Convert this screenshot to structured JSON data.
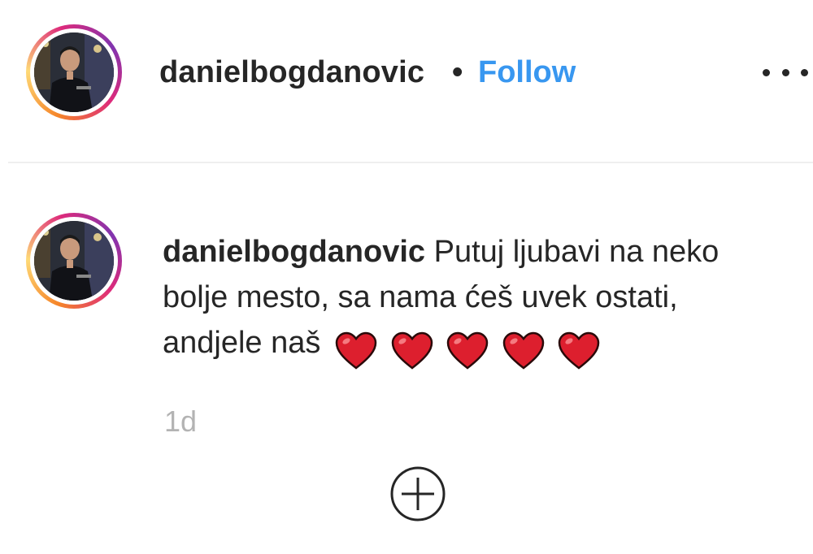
{
  "post_header": {
    "username": "danielbogdanovic",
    "separator": "•",
    "follow_label": "Follow",
    "more_icon": "more-options-icon",
    "colors": {
      "follow": "#3897f0",
      "text": "#262626"
    }
  },
  "comment": {
    "username": "danielbogdanovic",
    "text": "Putuj ljubavi na neko bolje mesto, sa nama ćeš uvek ostati, andjele naš",
    "emoji_count": 5,
    "emoji_icon": "red-heart-icon",
    "timestamp": "1d"
  },
  "load_more": {
    "icon": "add-circle-icon"
  }
}
